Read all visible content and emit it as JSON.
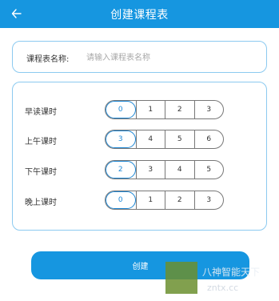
{
  "header": {
    "title": "创建课程表",
    "back_icon": "arrow-left-icon"
  },
  "name_field": {
    "label": "课程表名称:",
    "placeholder": "请输入课程表名称",
    "value": ""
  },
  "rows": [
    {
      "label": "早读课时",
      "options": [
        "0",
        "1",
        "2",
        "3"
      ],
      "selected": "0"
    },
    {
      "label": "上午课时",
      "options": [
        "3",
        "4",
        "5",
        "6"
      ],
      "selected": "3"
    },
    {
      "label": "下午课时",
      "options": [
        "2",
        "3",
        "4",
        "5"
      ],
      "selected": "2"
    },
    {
      "label": "晚上课时",
      "options": [
        "0",
        "1",
        "2",
        "3"
      ],
      "selected": "0"
    }
  ],
  "create_button": {
    "label": "创建"
  },
  "watermark": {
    "line1": "八神智能天下",
    "line2": "zntx.cc"
  },
  "colors": {
    "primary": "#1696e0",
    "border": "#8ccaf0",
    "selected": "#1e88d6"
  }
}
